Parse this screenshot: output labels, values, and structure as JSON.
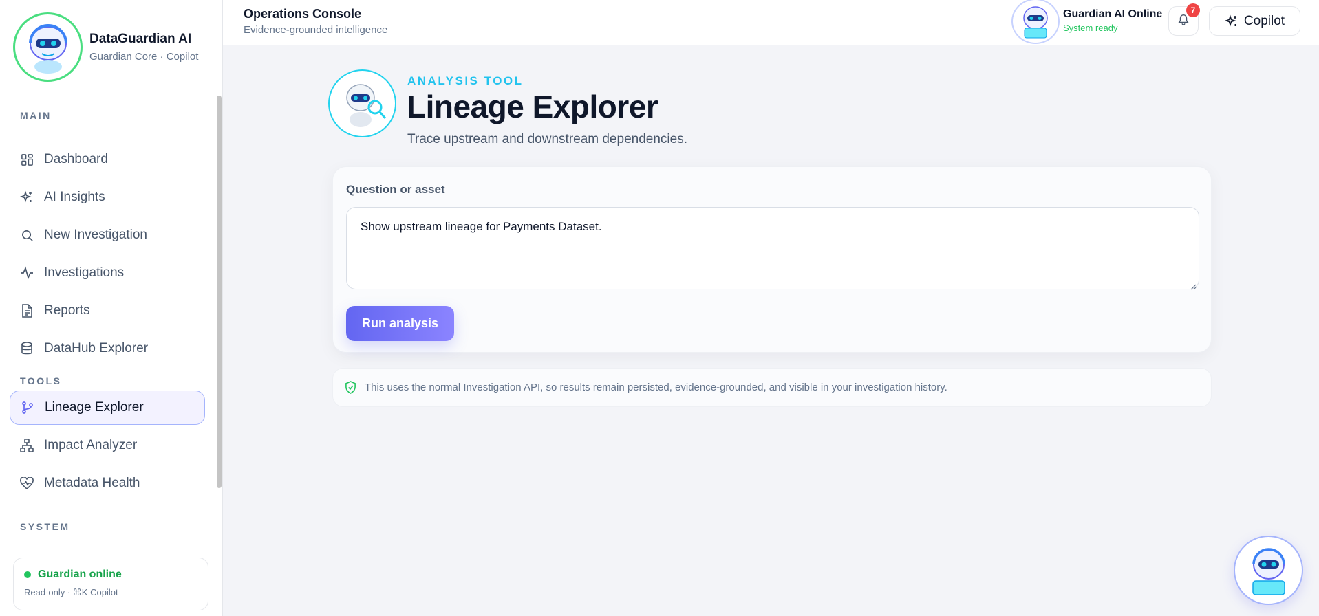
{
  "brand": {
    "name": "DataGuardian AI",
    "subtitle": "Guardian Core · Copilot"
  },
  "sidebar": {
    "sections": {
      "main": "MAIN",
      "tools": "TOOLS",
      "system": "SYSTEM"
    },
    "items": [
      {
        "label": "Dashboard",
        "icon": "dashboard-icon"
      },
      {
        "label": "AI Insights",
        "icon": "sparkles-icon"
      },
      {
        "label": "New Investigation",
        "icon": "search-icon"
      },
      {
        "label": "Investigations",
        "icon": "activity-icon"
      },
      {
        "label": "Reports",
        "icon": "document-icon"
      },
      {
        "label": "DataHub Explorer",
        "icon": "database-icon"
      },
      {
        "label": "Lineage Explorer",
        "icon": "git-branch-icon",
        "active": true
      },
      {
        "label": "Impact Analyzer",
        "icon": "network-icon"
      },
      {
        "label": "Metadata Health",
        "icon": "heart-pulse-icon"
      }
    ],
    "status": {
      "title": "Guardian online",
      "subtitle": "Read-only · ⌘K Copilot"
    }
  },
  "header": {
    "title": "Operations Console",
    "subtitle": "Evidence-grounded intelligence",
    "online_title": "Guardian AI Online",
    "online_sub": "System ready",
    "notifications": "7",
    "copilot_label": "Copilot"
  },
  "tool": {
    "kicker": "ANALYSIS TOOL",
    "title": "Lineage Explorer",
    "description": "Trace upstream and downstream dependencies.",
    "field_label": "Question or asset",
    "query_value": "Show upstream lineage for Payments Dataset.",
    "run_label": "Run analysis",
    "note": "This uses the normal Investigation API, so results remain persisted, evidence-grounded, and visible in your investigation history."
  },
  "colors": {
    "accent": "#6366f1",
    "online": "#22c55e",
    "kicker": "#22c3ee",
    "badge": "#ef4444"
  }
}
